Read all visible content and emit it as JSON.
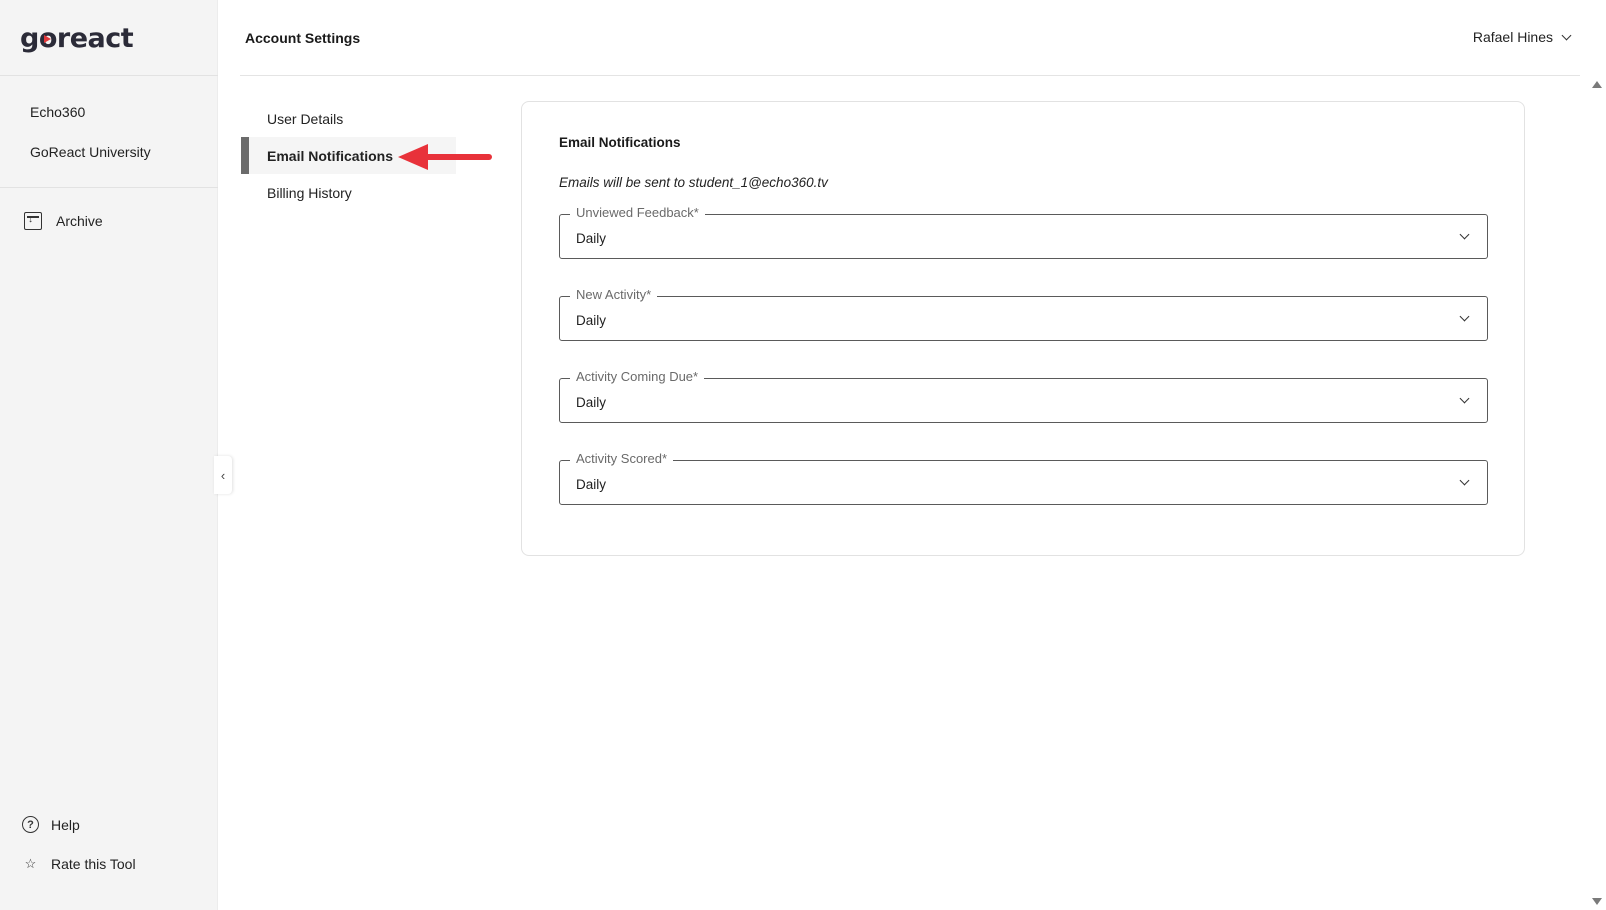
{
  "app": {
    "logo_text_start": "g",
    "logo_text_o": "o",
    "logo_text_end": "react"
  },
  "sidebar": {
    "items": [
      {
        "label": "Echo360"
      },
      {
        "label": "GoReact University"
      }
    ],
    "archive_label": "Archive",
    "help_label": "Help",
    "rate_label": "Rate this Tool",
    "collapse_glyph": "‹"
  },
  "header": {
    "title": "Account Settings",
    "user_name": "Rafael Hines"
  },
  "settings_nav": {
    "items": [
      {
        "label": "User Details",
        "active": false
      },
      {
        "label": "Email Notifications",
        "active": true
      },
      {
        "label": "Billing History",
        "active": false
      }
    ]
  },
  "email_notifications": {
    "title": "Email Notifications",
    "subtitle": "Emails will be sent to student_1@echo360.tv",
    "fields": [
      {
        "label": "Unviewed Feedback*",
        "value": "Daily"
      },
      {
        "label": "New Activity*",
        "value": "Daily"
      },
      {
        "label": "Activity Coming Due*",
        "value": "Daily"
      },
      {
        "label": "Activity Scored*",
        "value": "Daily"
      }
    ]
  },
  "colors": {
    "accent_red": "#e8323a",
    "active_bar": "#6b6b6b",
    "sidebar_bg": "#f4f4f4"
  },
  "icons": {
    "archive": "archive-icon",
    "help": "help-icon",
    "rate": "star-icon",
    "user_menu": "chevron-down-icon",
    "select": "chevron-down-icon",
    "collapse": "chevron-left-icon"
  }
}
